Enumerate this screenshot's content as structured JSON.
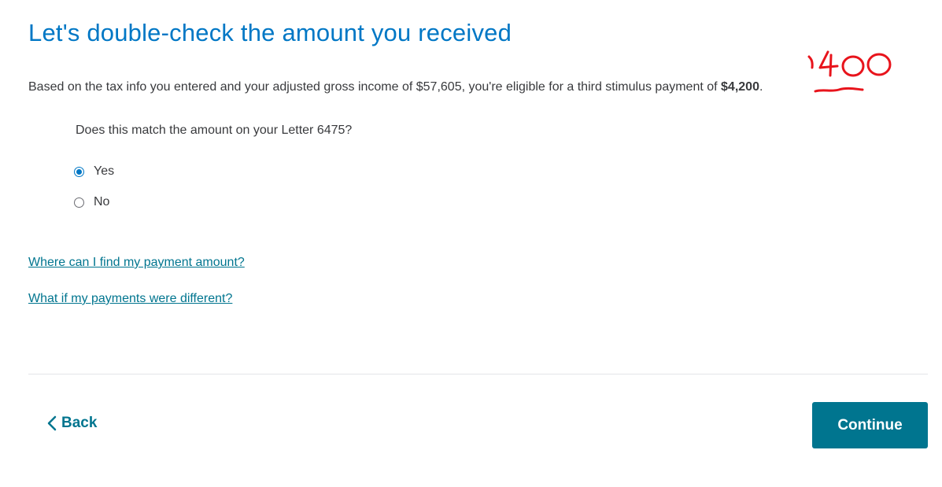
{
  "page": {
    "title": "Let's double-check the amount you received",
    "intro_text": "Based on the tax info you entered and your adjusted gross income of $57,605, you're eligible for a third stimulus payment of ",
    "intro_amount": "$4,200",
    "intro_period": ".",
    "handwritten_note": "1400",
    "question": "Does this match the amount on your Letter 6475?"
  },
  "options": [
    {
      "label": "Yes",
      "selected": true
    },
    {
      "label": "No",
      "selected": false
    }
  ],
  "links": {
    "find_amount": "Where can I find my payment amount?",
    "payments_different": "What if my payments were different?"
  },
  "footer": {
    "back_label": "Back",
    "continue_label": "Continue"
  },
  "colors": {
    "title": "#0077c5",
    "link": "#00758f",
    "primary_button": "#00758f",
    "annotation": "#e8141c"
  }
}
